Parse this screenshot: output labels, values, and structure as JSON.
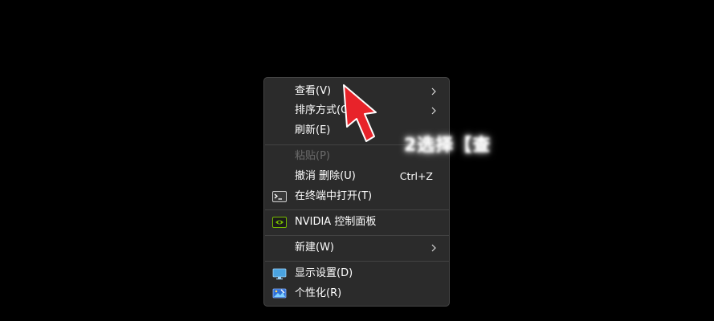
{
  "menu": {
    "items": [
      {
        "label": "查看(V)",
        "submenu": true,
        "icon": "",
        "disabled": false
      },
      {
        "label": "排序方式(O)",
        "submenu": true,
        "icon": "",
        "disabled": false
      },
      {
        "label": "刷新(E)",
        "submenu": false,
        "icon": "",
        "disabled": false
      },
      {
        "label": "粘贴(P)",
        "submenu": false,
        "icon": "",
        "disabled": true
      },
      {
        "label": "撤消 删除(U)",
        "shortcut": "Ctrl+Z",
        "submenu": false,
        "icon": "",
        "disabled": false
      },
      {
        "label": "在终端中打开(T)",
        "submenu": false,
        "icon": "terminal-icon",
        "disabled": false
      },
      {
        "label": "NVIDIA 控制面板",
        "submenu": false,
        "icon": "nvidia-icon",
        "disabled": false
      },
      {
        "label": "新建(W)",
        "submenu": true,
        "icon": "",
        "disabled": false
      },
      {
        "label": "显示设置(D)",
        "submenu": false,
        "icon": "display-settings-icon",
        "disabled": false
      },
      {
        "label": "个性化(R)",
        "submenu": false,
        "icon": "personalize-icon",
        "disabled": false
      }
    ]
  },
  "annotation": {
    "text": "2选择【查",
    "arrow_color": "#e8232a"
  },
  "colors": {
    "menu_bg": "#2b2b2b",
    "text": "#ffffff",
    "disabled_text": "#6c6c6c",
    "nvidia_green": "#76b900"
  }
}
